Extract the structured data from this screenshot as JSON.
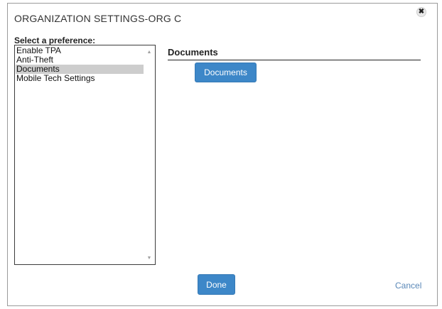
{
  "dialog": {
    "title": "ORGANIZATION SETTINGS-ORG C",
    "close_icon": "close-icon"
  },
  "preferences": {
    "label": "Select a preference:",
    "items": [
      {
        "label": "Enable TPA",
        "selected": false
      },
      {
        "label": "Anti-Theft",
        "selected": false
      },
      {
        "label": "Documents",
        "selected": true
      },
      {
        "label": "Mobile Tech Settings",
        "selected": false
      }
    ],
    "scroll_up_icon": "triangle-up-icon",
    "scroll_down_icon": "triangle-down-icon"
  },
  "panel": {
    "heading": "Documents",
    "button_label": "Documents"
  },
  "footer": {
    "done_label": "Done",
    "cancel_label": "Cancel"
  },
  "colors": {
    "primary_button": "#3d87c8",
    "selected_item": "#cdcdcd",
    "link": "#5a88b8"
  }
}
